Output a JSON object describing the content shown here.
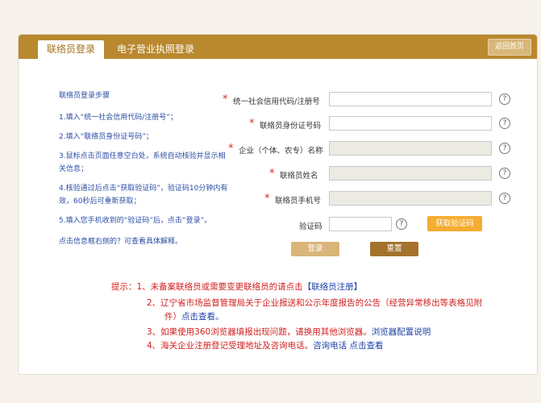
{
  "tabs": {
    "active": "联络员登录",
    "inactive": "电子营业执照登录"
  },
  "header": {
    "back_label": "返回首页"
  },
  "steps": {
    "title": "联络员登录步骤",
    "items": [
      "1.填入“统一社会信用代码/注册号”；",
      "2.填入“联络员身份证号码”；",
      "3.鼠标点击页面任意空白处，系统自动核验并显示相关信息；",
      "4.核验通过后点击“获取验证码”，验证码10分钟内有效，60秒后可重新获取；",
      "5.填入您手机收到的“验证码”后，点击“登录”。"
    ],
    "note": "点击信息框右侧的？可查看具体解释。"
  },
  "form": {
    "fields": [
      {
        "label": "统一社会信用代码/注册号",
        "value": ""
      },
      {
        "label": "联络员身份证号码",
        "value": ""
      },
      {
        "label": "企业（个体、农专）名称",
        "value": ""
      },
      {
        "label": "联络员姓名",
        "value": ""
      },
      {
        "label": "联络员手机号",
        "value": ""
      }
    ],
    "captcha_label": "验证码",
    "captcha_button": "获取验证码",
    "login_button": "登录",
    "reset_button": "重置",
    "help_glyph": "?"
  },
  "tips": {
    "line1_prefix": "提示：1、未备案联络员或需要变更联络员的请点击",
    "line1_link": "【联络员注册】",
    "line2a": "2、辽宁省市场监督管理局关于企业报送和公示年度报告的公告（经营异常移出等表格见附",
    "line2b_prefix": "件）",
    "line2b_link": "点击查看。",
    "line3_prefix": "3、如果使用360浏览器填报出现问题，请换用其他浏览器。",
    "line3_link": "浏览器配置说明",
    "line4_prefix": "4、海关企业注册登记受理地址及咨询电话。",
    "line4_link": "咨询电话 点击查看"
  }
}
